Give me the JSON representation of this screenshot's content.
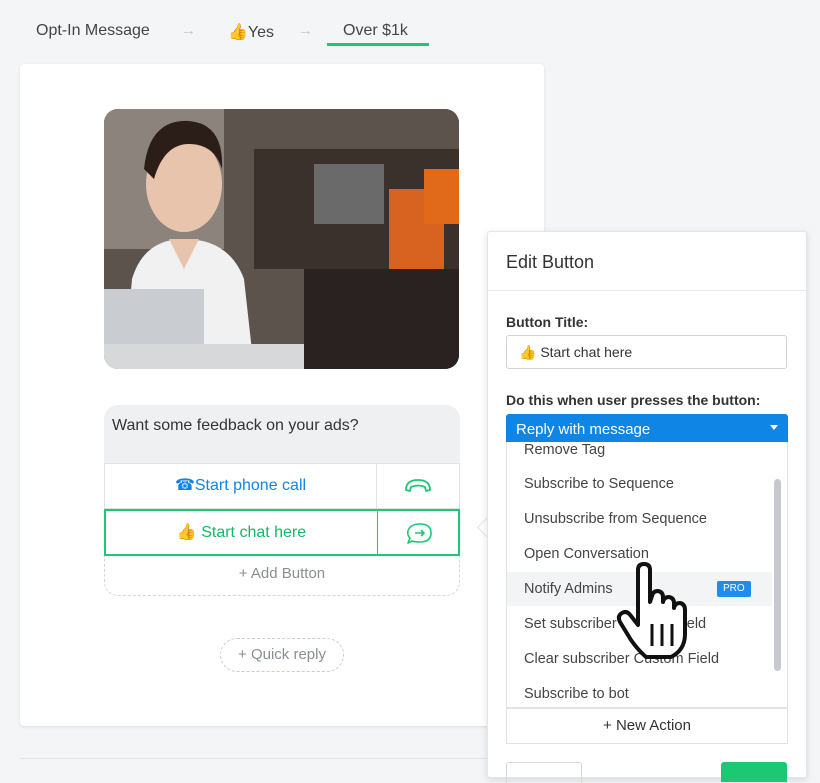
{
  "breadcrumb": {
    "items": [
      "Opt-In Message",
      "👍Yes",
      "Over $1k"
    ],
    "arrow": "→"
  },
  "message": {
    "text": "Want some feedback on your ads?",
    "buttons": [
      {
        "label": "☎Start phone call",
        "icon": "phone-icon"
      },
      {
        "label": "👍 Start chat here",
        "icon": "chat-bubble-icon"
      }
    ],
    "add_button": "+ Add Button",
    "quick_reply": "+ Quick reply"
  },
  "edit_panel": {
    "title": "Edit Button",
    "button_title_label": "Button Title:",
    "button_title_value": "👍 Start chat here",
    "action_label": "Do this when user presses the button:",
    "selected_action": "Reply with message",
    "options": [
      "Remove Tag",
      "Subscribe to Sequence",
      "Unsubscribe from Sequence",
      "Open Conversation",
      "Notify Admins",
      "Set subscriber Custom Field",
      "Clear subscriber Custom Field",
      "Subscribe to bot"
    ],
    "pro_badge": "PRO",
    "new_action": "+ New Action"
  },
  "colors": {
    "accent_green": "#1ec773",
    "link_blue": "#0f85e6",
    "pro_blue": "#1f8cf0"
  }
}
